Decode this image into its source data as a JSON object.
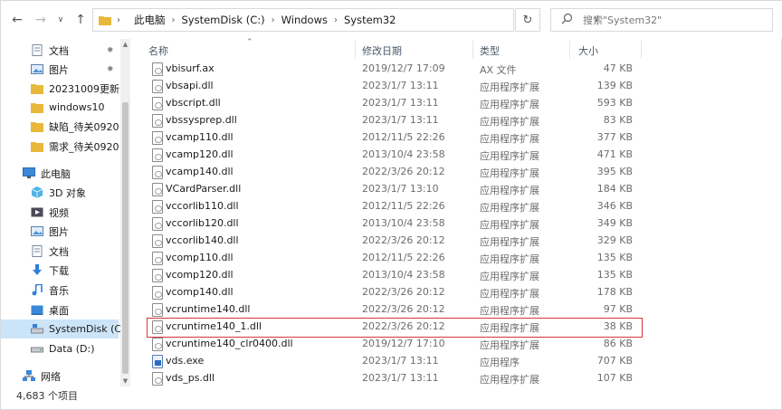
{
  "address": {
    "crumbs": [
      "此电脑",
      "SystemDisk (C:)",
      "Windows",
      "System32"
    ]
  },
  "search": {
    "placeholder": "搜索\"System32\""
  },
  "nav": {
    "items": [
      {
        "label": "文档",
        "icon": "documents-icon",
        "pinned": true
      },
      {
        "label": "图片",
        "icon": "pictures-icon",
        "pinned": true
      },
      {
        "label": "20231009更新",
        "icon": "folder-icon"
      },
      {
        "label": "windows10",
        "icon": "folder-icon"
      },
      {
        "label": "缺陷_待关0920",
        "icon": "folder-icon"
      },
      {
        "label": "需求_待关0920",
        "icon": "folder-icon"
      },
      {
        "label": "此电脑",
        "icon": "computer-icon"
      },
      {
        "label": "3D 对象",
        "icon": "3d-objects-icon"
      },
      {
        "label": "视频",
        "icon": "videos-icon"
      },
      {
        "label": "图片",
        "icon": "pictures-icon"
      },
      {
        "label": "文档",
        "icon": "documents-icon"
      },
      {
        "label": "下载",
        "icon": "downloads-icon"
      },
      {
        "label": "音乐",
        "icon": "music-icon"
      },
      {
        "label": "桌面",
        "icon": "desktop-icon"
      },
      {
        "label": "SystemDisk (C:)",
        "icon": "system-drive-icon",
        "selected": true
      },
      {
        "label": "Data (D:)",
        "icon": "drive-icon"
      },
      {
        "label": "网络",
        "icon": "network-icon"
      }
    ]
  },
  "columns": {
    "name": "名称",
    "date": "修改日期",
    "type": "类型",
    "size": "大小"
  },
  "files": [
    {
      "name": "vbisurf.ax",
      "date": "2019/12/7 17:09",
      "type": "AX 文件",
      "size": "47 KB",
      "kind": "dll"
    },
    {
      "name": "vbsapi.dll",
      "date": "2023/1/7 13:11",
      "type": "应用程序扩展",
      "size": "139 KB",
      "kind": "dll"
    },
    {
      "name": "vbscript.dll",
      "date": "2023/1/7 13:11",
      "type": "应用程序扩展",
      "size": "593 KB",
      "kind": "dll"
    },
    {
      "name": "vbssysprep.dll",
      "date": "2023/1/7 13:11",
      "type": "应用程序扩展",
      "size": "83 KB",
      "kind": "dll"
    },
    {
      "name": "vcamp110.dll",
      "date": "2012/11/5 22:26",
      "type": "应用程序扩展",
      "size": "377 KB",
      "kind": "dll"
    },
    {
      "name": "vcamp120.dll",
      "date": "2013/10/4 23:58",
      "type": "应用程序扩展",
      "size": "471 KB",
      "kind": "dll"
    },
    {
      "name": "vcamp140.dll",
      "date": "2022/3/26 20:12",
      "type": "应用程序扩展",
      "size": "395 KB",
      "kind": "dll"
    },
    {
      "name": "VCardParser.dll",
      "date": "2023/1/7 13:10",
      "type": "应用程序扩展",
      "size": "184 KB",
      "kind": "dll"
    },
    {
      "name": "vccorlib110.dll",
      "date": "2012/11/5 22:26",
      "type": "应用程序扩展",
      "size": "346 KB",
      "kind": "dll"
    },
    {
      "name": "vccorlib120.dll",
      "date": "2013/10/4 23:58",
      "type": "应用程序扩展",
      "size": "349 KB",
      "kind": "dll"
    },
    {
      "name": "vccorlib140.dll",
      "date": "2022/3/26 20:12",
      "type": "应用程序扩展",
      "size": "329 KB",
      "kind": "dll"
    },
    {
      "name": "vcomp110.dll",
      "date": "2012/11/5 22:26",
      "type": "应用程序扩展",
      "size": "135 KB",
      "kind": "dll"
    },
    {
      "name": "vcomp120.dll",
      "date": "2013/10/4 23:58",
      "type": "应用程序扩展",
      "size": "135 KB",
      "kind": "dll"
    },
    {
      "name": "vcomp140.dll",
      "date": "2022/3/26 20:12",
      "type": "应用程序扩展",
      "size": "178 KB",
      "kind": "dll"
    },
    {
      "name": "vcruntime140.dll",
      "date": "2022/3/26 20:12",
      "type": "应用程序扩展",
      "size": "97 KB",
      "kind": "dll"
    },
    {
      "name": "vcruntime140_1.dll",
      "date": "2022/3/26 20:12",
      "type": "应用程序扩展",
      "size": "38 KB",
      "kind": "dll",
      "highlighted": true
    },
    {
      "name": "vcruntime140_clr0400.dll",
      "date": "2019/12/7 17:10",
      "type": "应用程序扩展",
      "size": "86 KB",
      "kind": "dll"
    },
    {
      "name": "vds.exe",
      "date": "2023/1/7 13:11",
      "type": "应用程序",
      "size": "707 KB",
      "kind": "exe"
    },
    {
      "name": "vds_ps.dll",
      "date": "2023/1/7 13:11",
      "type": "应用程序扩展",
      "size": "107 KB",
      "kind": "dll"
    }
  ],
  "status": {
    "item_count": "4,683 个项目"
  },
  "colors": {
    "highlight_border": "#d9333a",
    "selected_bg": "#cce4f7",
    "folder": "#e8b83a"
  }
}
